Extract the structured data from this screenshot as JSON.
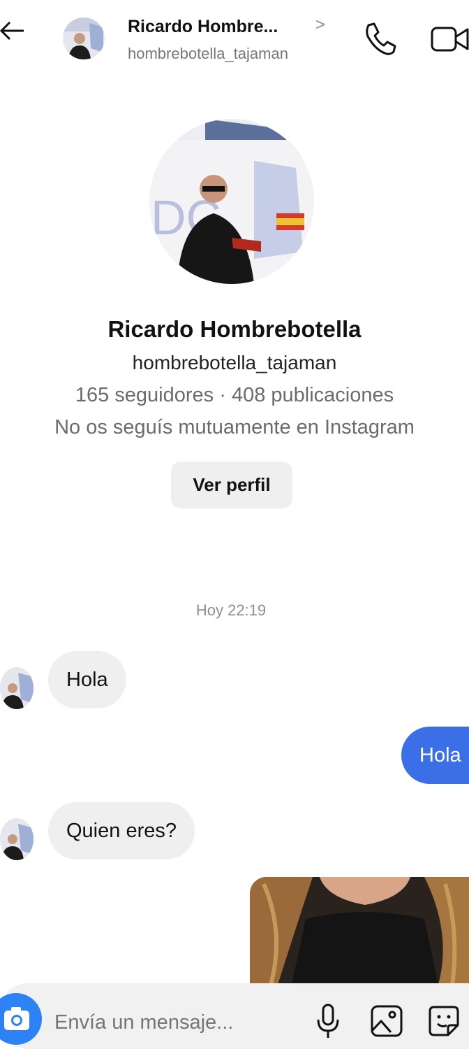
{
  "header": {
    "name": "Ricardo Hombre...",
    "username": "hombrebotella_tajaman",
    "chevron": ">"
  },
  "profile": {
    "name": "Ricardo Hombrebotella",
    "username": "hombrebotella_tajaman",
    "stats": "165 seguidores · 408 publicaciones",
    "mutual": "No os seguís mutuamente en Instagram",
    "view_button": "Ver perfil"
  },
  "chat": {
    "timestamp": "Hoy 22:19",
    "messages": [
      {
        "from": "them",
        "text": "Hola"
      },
      {
        "from": "me",
        "text": "Hola"
      },
      {
        "from": "them",
        "text": "Quien eres?"
      },
      {
        "from": "me",
        "type": "photo"
      }
    ]
  },
  "composer": {
    "placeholder": "Envía un mensaje..."
  },
  "icons": {
    "back": "arrow-left-icon",
    "call": "phone-icon",
    "video": "video-camera-icon",
    "camera": "camera-icon",
    "mic": "microphone-icon",
    "gallery": "image-icon",
    "sticker": "sticker-icon"
  },
  "colors": {
    "outgoing_bubble": "#3a6fe8",
    "incoming_bubble": "#efefef",
    "camera_button": "#2d83f5"
  }
}
